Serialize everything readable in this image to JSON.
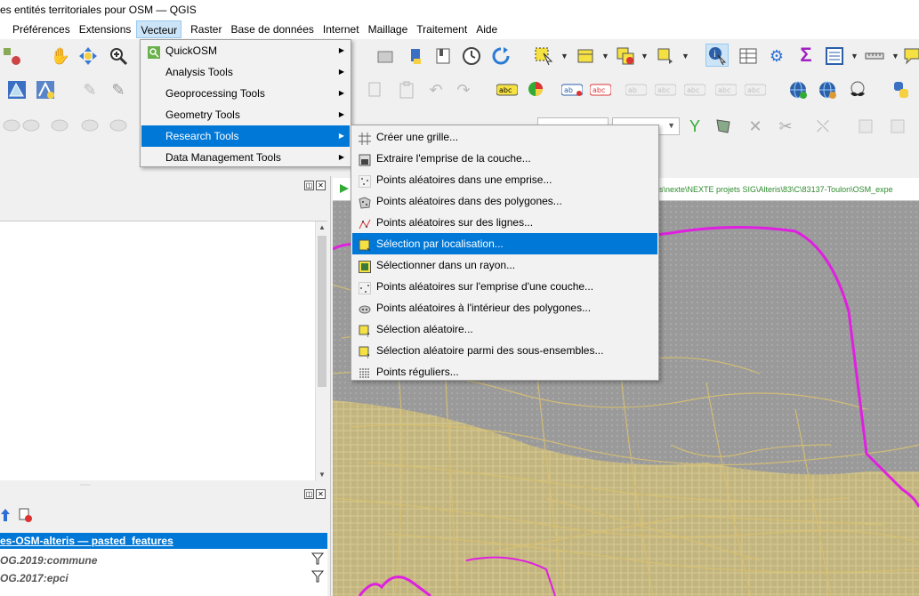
{
  "window": {
    "title": "es entités territoriales pour OSM — QGIS"
  },
  "menubar": {
    "items": [
      {
        "label": "Préférences",
        "key": "prefs"
      },
      {
        "label": "Extensions",
        "key": "ext"
      },
      {
        "label": "Vecteur",
        "key": "vect",
        "active": true
      },
      {
        "label": "Raster",
        "key": "raster"
      },
      {
        "label": "Base de données",
        "key": "db"
      },
      {
        "label": "Internet",
        "key": "web"
      },
      {
        "label": "Maillage",
        "key": "mesh"
      },
      {
        "label": "Traitement",
        "key": "proc"
      },
      {
        "label": "Aide",
        "key": "help"
      }
    ]
  },
  "vector_menu": {
    "items": [
      {
        "label": "QuickOSM",
        "submenu": true,
        "icon": "quickosm-icon"
      },
      {
        "label": "Analysis Tools",
        "submenu": true
      },
      {
        "label": "Geoprocessing Tools",
        "submenu": true
      },
      {
        "label": "Geometry Tools",
        "submenu": true
      },
      {
        "label": "Research Tools",
        "submenu": true,
        "highlighted": true
      },
      {
        "label": "Data Management Tools",
        "submenu": true
      }
    ]
  },
  "research_menu": {
    "items": [
      {
        "label": "Créer une grille...",
        "icon": "grid-icon"
      },
      {
        "label": "Extraire l'emprise de la couche...",
        "icon": "extent-icon"
      },
      {
        "label": "Points aléatoires dans une emprise...",
        "icon": "random-points-extent-icon"
      },
      {
        "label": "Points aléatoires dans des polygones...",
        "icon": "random-points-polygons-icon"
      },
      {
        "label": "Points aléatoires sur des lignes...",
        "icon": "random-points-lines-icon"
      },
      {
        "label": "Sélection par localisation...",
        "icon": "select-by-location-icon",
        "highlighted": true
      },
      {
        "label": "Sélectionner dans un rayon...",
        "icon": "select-within-distance-icon"
      },
      {
        "label": "Points aléatoires sur l'emprise d'une couche...",
        "icon": "random-points-layer-extent-icon"
      },
      {
        "label": "Points aléatoires à l'intérieur des polygones...",
        "icon": "random-points-inside-polygons-icon"
      },
      {
        "label": "Sélection aléatoire...",
        "icon": "random-selection-icon"
      },
      {
        "label": "Sélection aléatoire parmi des sous-ensembles...",
        "icon": "random-selection-subsets-icon"
      },
      {
        "label": "Points réguliers...",
        "icon": "regular-points-icon"
      }
    ]
  },
  "path_bar": {
    "text": "rs\\nexte\\NEXTE projets SIG\\Alteris\\83\\C\\83137-Toulon\\OSM_expe"
  },
  "layers_panel": {
    "group_header": "es-OSM-alteris — pasted_features",
    "items": [
      {
        "label": "OG.2019:commune"
      },
      {
        "label": "OG.2017:epci"
      }
    ]
  },
  "colors": {
    "selection": "#0078d7",
    "boundary": "#e020e0",
    "roads": "#d8c070",
    "path_text": "#2e8b2e"
  }
}
